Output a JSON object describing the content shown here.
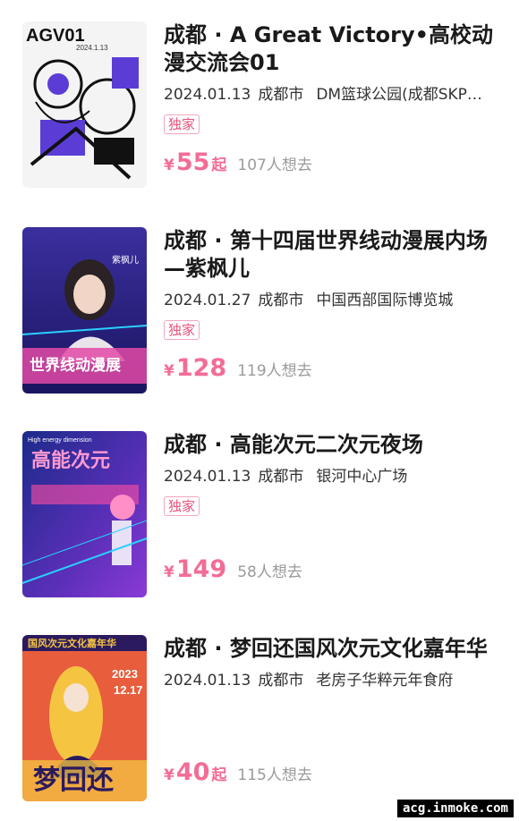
{
  "events": [
    {
      "title": "成都 · A Great Victory•高校动漫交流会01",
      "date": "2024.01.13",
      "city": "成都市",
      "venue": "DM篮球公园(成都SKP…",
      "badge": "独家",
      "currency": "¥",
      "price": "55",
      "price_suffix": "起",
      "want": "107人想去",
      "poster": {
        "text_main": "AGV01",
        "text_sub": "2024.1.13",
        "colors": [
          "#ffffff",
          "#5b3dd6",
          "#111111"
        ]
      }
    },
    {
      "title": "成都 · 第十四届世界线动漫展内场—紫枫儿",
      "date": "2024.01.27",
      "city": "成都市",
      "venue": "中国西部国际博览城",
      "badge": "独家",
      "currency": "¥",
      "price": "128",
      "price_suffix": "",
      "want": "119人想去",
      "poster": {
        "text_main": "世界线动漫展",
        "text_sub": "紫枫儿",
        "colors": [
          "#3b2f9e",
          "#e24aa6",
          "#2ad0ff"
        ]
      }
    },
    {
      "title": "成都 · 高能次元二次元夜场",
      "date": "2024.01.13",
      "city": "成都市",
      "venue": "银河中心广场",
      "badge": "独家",
      "currency": "¥",
      "price": "149",
      "price_suffix": "",
      "want": "58人想去",
      "poster": {
        "text_main": "高能次元",
        "text_sub": "High energy dimension",
        "colors": [
          "#1c2a8a",
          "#8a3ad6",
          "#ff4fa3"
        ]
      }
    },
    {
      "title": "成都 · 梦回还国风次元文化嘉年华",
      "date": "2024.01.13",
      "city": "成都市",
      "venue": "老房子华粹元年食府",
      "badge": "",
      "currency": "¥",
      "price": "40",
      "price_suffix": "起",
      "want": "115人想去",
      "poster": {
        "text_main": "梦回还",
        "text_sub": "国风次元文化嘉年华",
        "text_date1": "2023",
        "text_date2": "12.17",
        "colors": [
          "#e85d3c",
          "#f5c542",
          "#2b1a5e"
        ]
      }
    }
  ],
  "watermark": "acg.inmoke.com"
}
